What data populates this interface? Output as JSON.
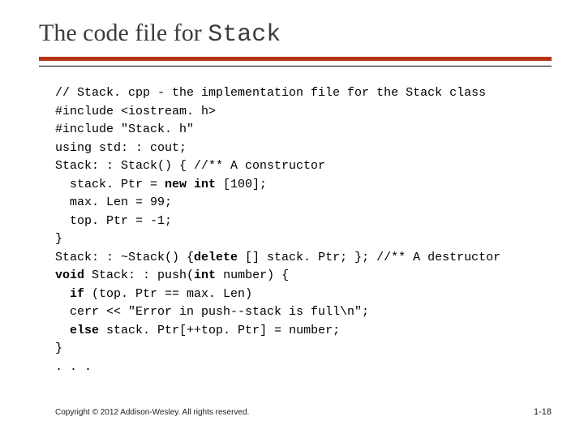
{
  "title_prefix": "The code file for ",
  "title_mono": "Stack",
  "code": {
    "l1": "// Stack. cpp - the implementation file for the Stack class",
    "l2": "#include <iostream. h>",
    "l3": "#include ″Stack. h″",
    "l4": "using std: : cout;",
    "l5": "Stack: : Stack() { //** A constructor",
    "l6a": "  stack. Ptr = ",
    "l6b": "new int",
    "l6c": " [100];",
    "l7": "  max. Len = 99;",
    "l8": "  top. Ptr = -1;",
    "l9": "}",
    "l10a": "Stack: : ~Stack() {",
    "l10b": "delete",
    "l10c": " [] stack. Ptr; }; //** A destructor",
    "l11a": "void",
    "l11b": " Stack: : push(",
    "l11c": "int",
    "l11d": " number) {",
    "l12a": "  ",
    "l12b": "if",
    "l12c": " (top. Ptr == max. Len)",
    "l13": "  cerr << ″Error in push--stack is full\\n″;",
    "l14a": "  ",
    "l14b": "else",
    "l14c": " stack. Ptr[++top. Ptr] = number;",
    "l15": "}",
    "l16": ". . ."
  },
  "footer": "Copyright © 2012 Addison-Wesley. All rights reserved.",
  "page": "1-18"
}
